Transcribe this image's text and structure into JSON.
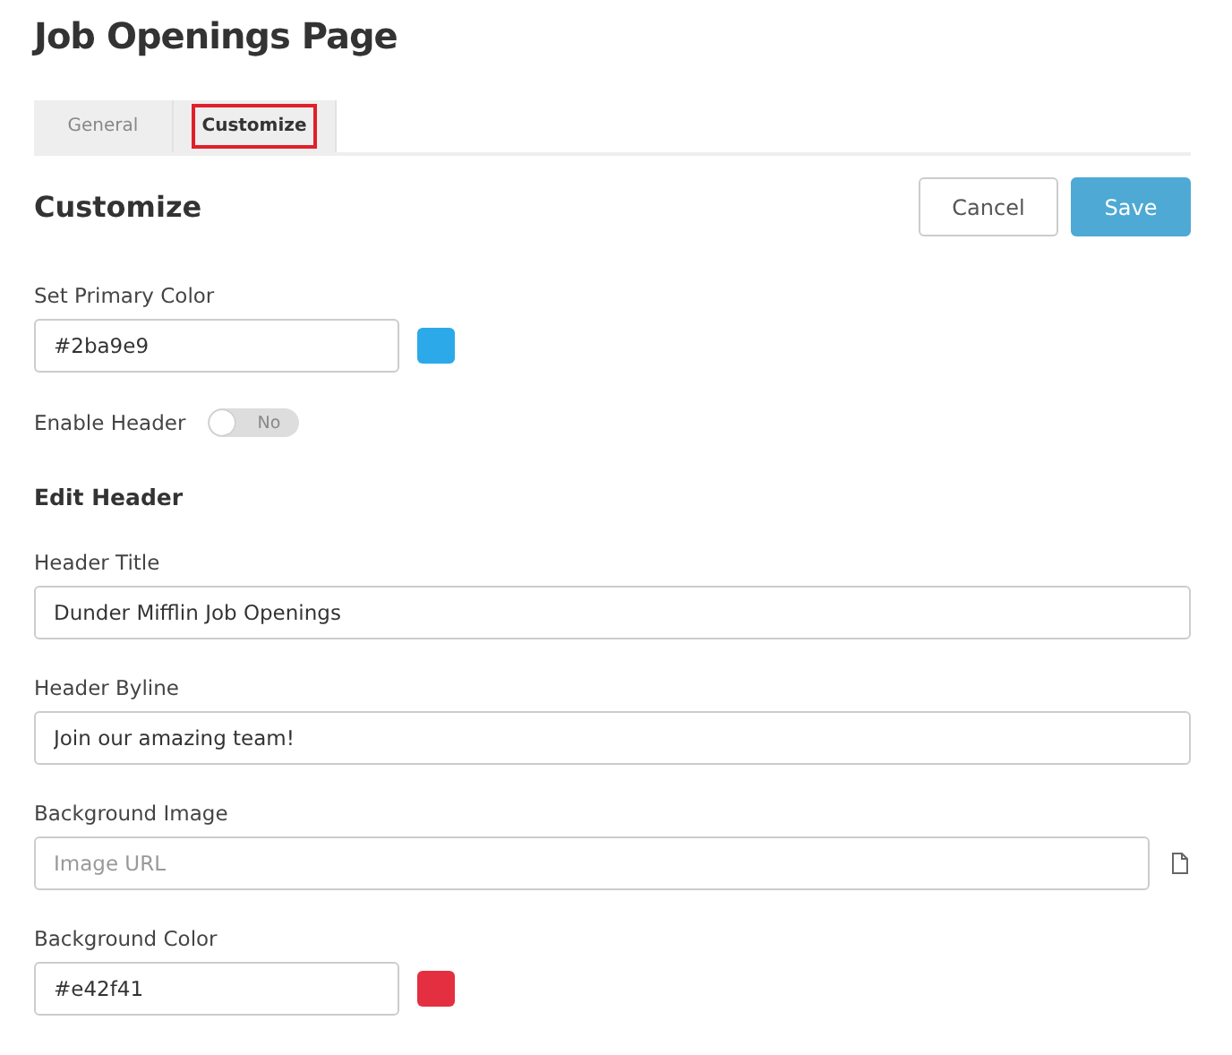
{
  "page_title": "Job Openings Page",
  "tabs": [
    {
      "label": "General",
      "selected": false
    },
    {
      "label": "Customize",
      "selected": true
    }
  ],
  "section_title": "Customize",
  "buttons": [
    {
      "label": "Cancel",
      "kind": "secondary"
    },
    {
      "label": "Save",
      "kind": "primary"
    }
  ],
  "primary_color": {
    "label": "Set Primary Color",
    "value": "#2ba9e9",
    "color": "#2ba9e9"
  },
  "enable_header": {
    "label": "Enable Header",
    "on": false,
    "state_text": "No"
  },
  "edit_header": {
    "title": "Edit Header",
    "fields": [
      {
        "kind": "text",
        "label": "Header Title",
        "value": "Dunder Mifflin Job Openings"
      },
      {
        "kind": "text",
        "label": "Header Byline",
        "value": "Join our amazing team!"
      },
      {
        "kind": "file",
        "label": "Background Image",
        "placeholder": "Image URL"
      },
      {
        "kind": "color",
        "label": "Background Color",
        "value": "#e42f41",
        "color": "#e42f41"
      }
    ]
  }
}
